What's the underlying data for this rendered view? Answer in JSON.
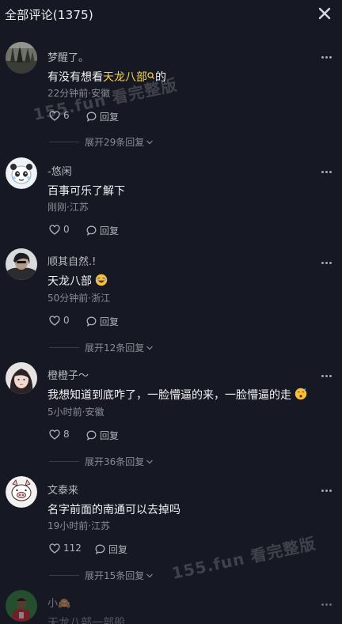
{
  "header": {
    "title": "全部评论(1375)"
  },
  "comments": [
    {
      "username": "梦醒了。",
      "content_before": "有没有想看",
      "content_highlight": "天龙八部",
      "content_after": "的",
      "meta": "22分钟前·安徽",
      "likes": "6",
      "reply_label": "回复",
      "expand_label": "展开29条回复",
      "avatar": "landscape-avatar"
    },
    {
      "username": "-悠闲",
      "content": "百事可乐了解下",
      "meta": "刚刚·江苏",
      "likes": "0",
      "reply_label": "回复",
      "avatar": "panda-avatar"
    },
    {
      "username": "顺其自然.!",
      "content": "天龙八部",
      "meta": "50分钟前·浙江",
      "likes": "0",
      "reply_label": "回复",
      "expand_label": "展开12条回复",
      "avatar": "portrait-avatar",
      "emoji": "laughing-emoji"
    },
    {
      "username": "橙橙子～",
      "content": "我想知道到底咋了，一脸懵逼的来，一脸懵逼的走",
      "meta": "5小时前·安徽",
      "likes": "8",
      "reply_label": "回复",
      "expand_label": "展开36条回复",
      "avatar": "girl-avatar",
      "emoji": "confused-emoji"
    },
    {
      "username": "文泰来",
      "content": "名字前面的南通可以去掉吗",
      "meta": "19小时前·江苏",
      "likes": "112",
      "reply_label": "回复",
      "expand_label": "展开15条回复",
      "avatar": "pig-avatar"
    },
    {
      "username": "小🙈",
      "content": "天龙八部一部般",
      "avatar": "jersey-avatar"
    }
  ],
  "watermarks": [
    "155.fun 看完整版",
    "155.fun 看完整版"
  ],
  "colors": {
    "background": "#161823",
    "highlight": "#f5d34a",
    "muted": "#8a8b93"
  }
}
